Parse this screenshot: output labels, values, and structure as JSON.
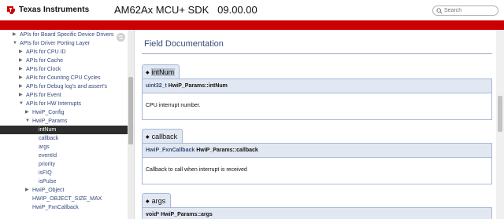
{
  "header": {
    "brand": "Texas Instruments",
    "title": "AM62Ax MCU+ SDK   09.00.00",
    "search_placeholder": "Search",
    "brand_color": "#cc0000"
  },
  "sidebar": {
    "items": [
      {
        "label": "APIs for Board Specific Device Drivers",
        "arrow": "▶",
        "depth": 1
      },
      {
        "label": "APIs for Driver Porting Layer",
        "arrow": "▼",
        "depth": 1
      },
      {
        "label": "APIs for CPU ID",
        "arrow": "▶",
        "depth": 2
      },
      {
        "label": "APIs for Cache",
        "arrow": "▶",
        "depth": 2
      },
      {
        "label": "APIs for Clock",
        "arrow": "▶",
        "depth": 2
      },
      {
        "label": "APIs for Counting CPU Cycles",
        "arrow": "▶",
        "depth": 2
      },
      {
        "label": "APIs for Debug log's and assert's",
        "arrow": "▶",
        "depth": 2
      },
      {
        "label": "APIs for Event",
        "arrow": "▶",
        "depth": 2
      },
      {
        "label": "APIs for HW Interrupts",
        "arrow": "▼",
        "depth": 2
      },
      {
        "label": "HwiP_Config",
        "arrow": "▶",
        "depth": 3
      },
      {
        "label": "HwiP_Params",
        "arrow": "▼",
        "depth": 3
      },
      {
        "label": "intNum",
        "arrow": "",
        "depth": 4,
        "selected": true
      },
      {
        "label": "callback",
        "arrow": "",
        "depth": 4
      },
      {
        "label": "args",
        "arrow": "",
        "depth": 4
      },
      {
        "label": "eventId",
        "arrow": "",
        "depth": 4
      },
      {
        "label": "priority",
        "arrow": "",
        "depth": 4
      },
      {
        "label": "isFIQ",
        "arrow": "",
        "depth": 4
      },
      {
        "label": "isPulse",
        "arrow": "",
        "depth": 4
      },
      {
        "label": "HwiP_Object",
        "arrow": "▶",
        "depth": 3
      },
      {
        "label": "HWIP_OBJECT_SIZE_MAX",
        "arrow": "",
        "depth": 3
      },
      {
        "label": "HwiP_FxnCallback",
        "arrow": "",
        "depth": 3
      }
    ]
  },
  "content": {
    "heading": "Field Documentation",
    "fields": [
      {
        "name": "intNum",
        "proto_type": "uint32_t",
        "proto_name": "HwiP_Params::intNum",
        "description": "CPU interrupt number."
      },
      {
        "name": "callback",
        "proto_type": "HwiP_FxnCallback",
        "proto_name": "HwiP_Params::callback",
        "description": "Callback to call when interrupt is received"
      },
      {
        "name": "args",
        "proto_type": "void*",
        "proto_name": "HwiP_Params::args",
        "description": ""
      }
    ]
  }
}
